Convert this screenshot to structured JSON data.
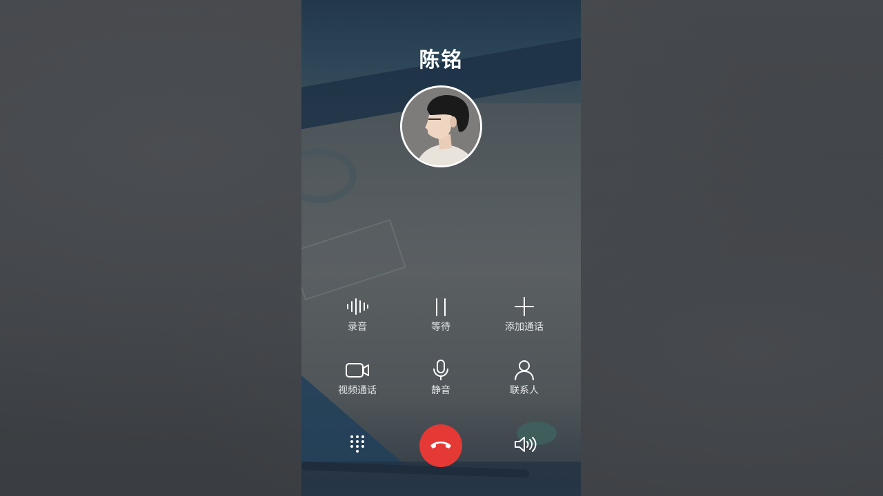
{
  "call": {
    "contact_name": "陈铭"
  },
  "actions_row1": [
    {
      "label": "录音",
      "icon": "waveform-icon"
    },
    {
      "label": "等待",
      "icon": "pause-icon"
    },
    {
      "label": "添加通话",
      "icon": "plus-icon"
    }
  ],
  "actions_row2": [
    {
      "label": "视频通话",
      "icon": "video-camera-icon"
    },
    {
      "label": "静音",
      "icon": "microphone-icon"
    },
    {
      "label": "联系人",
      "icon": "person-icon"
    }
  ],
  "bottom_bar": {
    "dialpad_icon": "dialpad-icon",
    "hangup_icon": "phone-hangup-icon",
    "hangup_color": "#e53935",
    "speaker_icon": "speaker-icon"
  }
}
